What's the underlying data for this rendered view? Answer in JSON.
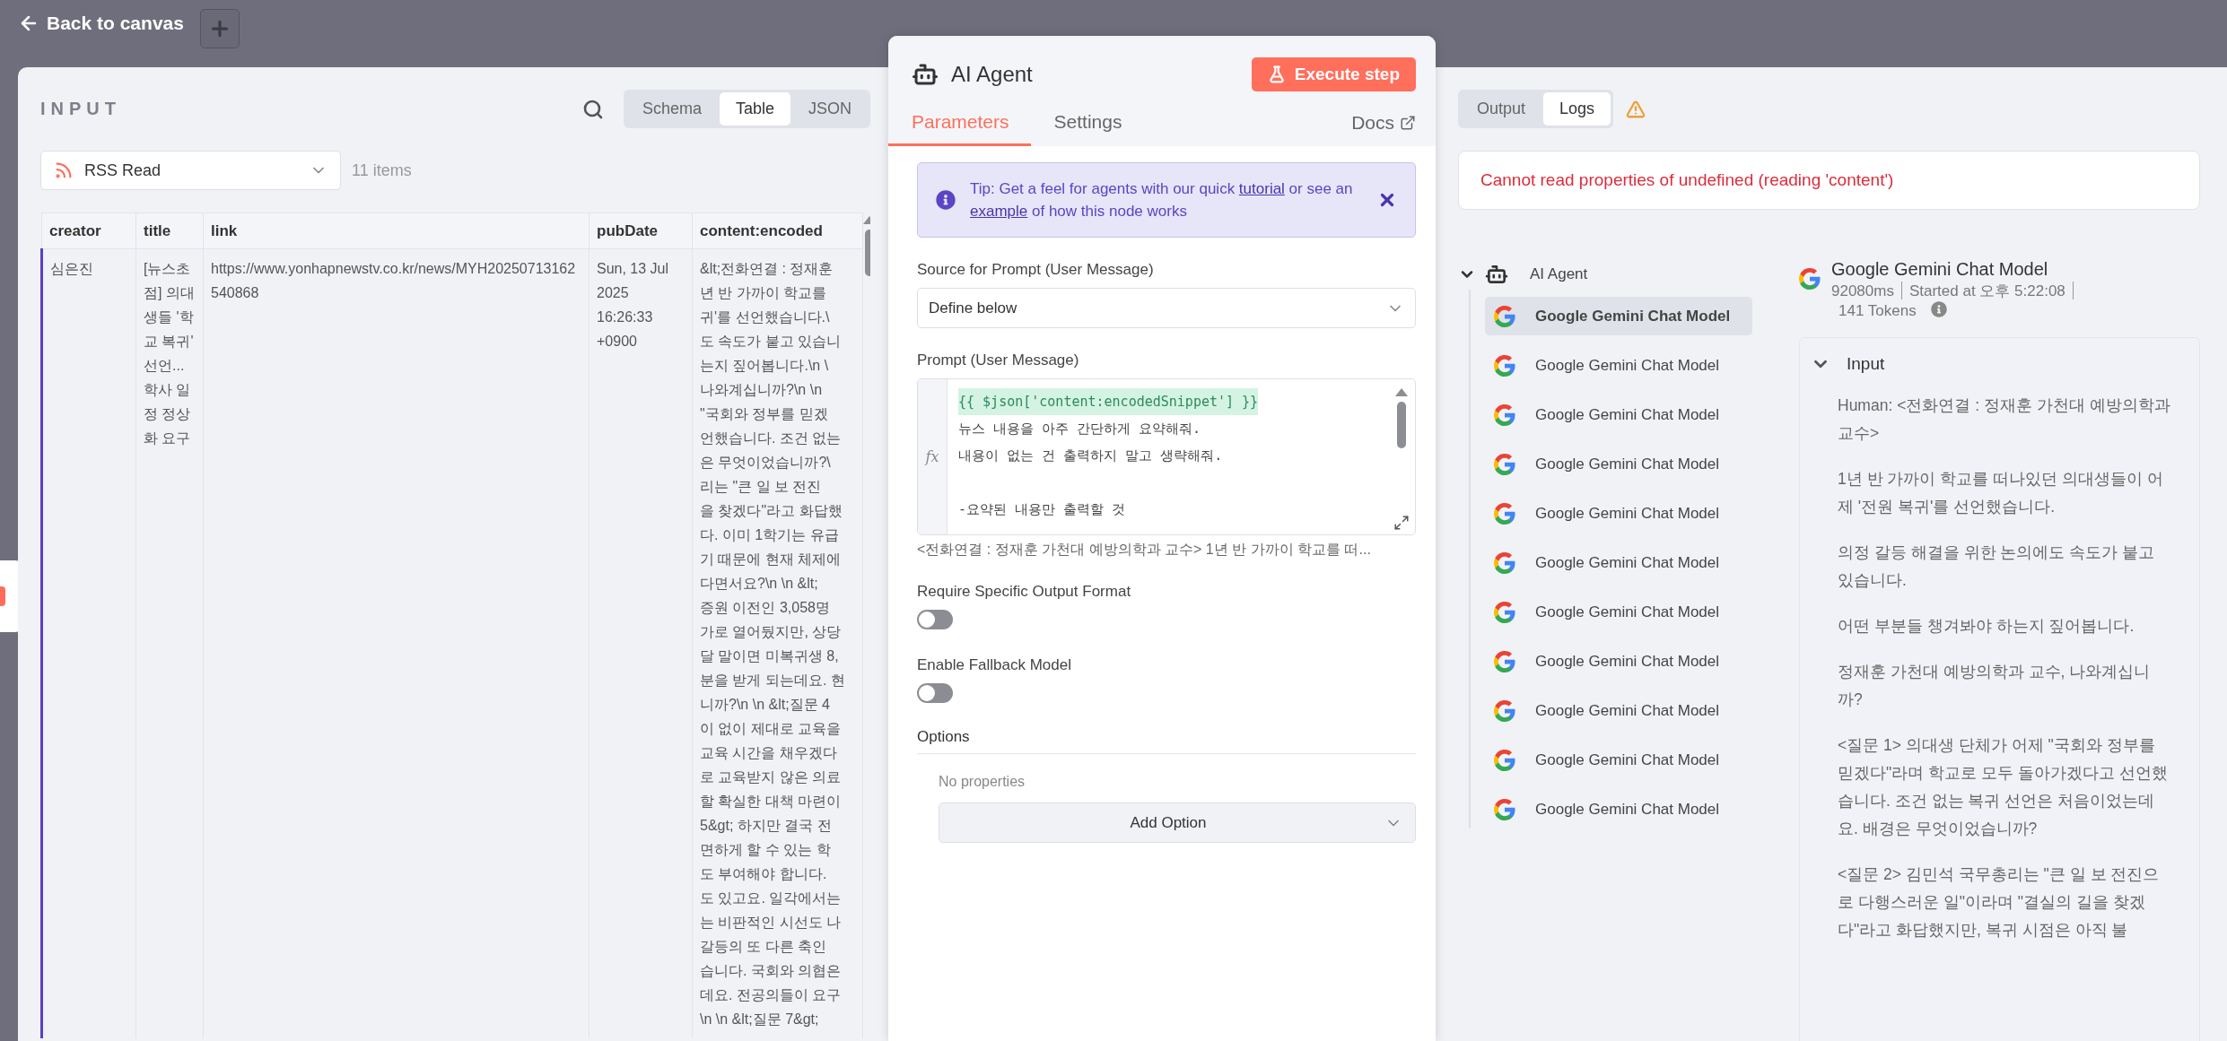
{
  "top_bar": {
    "back_label": "Back to canvas"
  },
  "input_panel": {
    "title": "INPUT",
    "views": [
      {
        "label": "Schema",
        "selected": false
      },
      {
        "label": "Table",
        "selected": true
      },
      {
        "label": "JSON",
        "selected": false
      }
    ],
    "source": "RSS Read",
    "item_count": "11 items",
    "table": {
      "columns": [
        "creator",
        "title",
        "link",
        "pubDate",
        "content:encoded"
      ],
      "rows": [
        {
          "selected": true,
          "creator": "심은진",
          "title": "[뉴스초점] 의대생들 '학교 복귀' 선언... 학사 일정 정상화 요구",
          "link": "https://www.yonhapnewstv.co.kr/news/MYH20250713162540868",
          "pubDate": "Sun, 13 Jul 2025 16:26:33 +0900",
          "content_lines": [
            "&lt;전화연결 : 정재훈",
            "년 반 가까이 학교를",
            "귀'를 선언했습니다.\\",
            "도 속도가 붙고 있습니",
            "는지 짚어봅니다.\\n \\",
            "나와계십니까?\\n \\n",
            "\"국회와 정부를 믿겠",
            "언했습니다. 조건 없는",
            "은 무엇이었습니까?\\",
            "리는 \"큰 일 보 전진",
            "을 찾겠다\"라고 화답했",
            "다. 이미 1학기는 유급",
            "기 때문에 현재 체제에",
            "다면서요?\\n \\n &lt;",
            "증원 이전인 3,058명",
            "가로 열어뒀지만, 상당",
            "달 말이면 미복귀생 8,",
            "분을 받게 되는데요. 현",
            "니까?\\n \\n &lt;질문 4",
            "이 없이 제대로 교육을",
            "교육 시간을 채우겠다",
            "로 교육받지 않은 의료",
            "할 확실한 대책 마련이",
            "5&gt; 하지만 결국 전",
            "면하게 할 수 있는 학",
            "도 부여해야 합니다.",
            "도 있고요. 일각에서는",
            "는 비판적인 시선도 나",
            "갈등의 또 다른 축인",
            "습니다. 국회와 의협은",
            "데요. 전공의들이 요구",
            "\\n \\n &lt;질문 7&gt;"
          ]
        }
      ]
    }
  },
  "node_panel": {
    "title": "AI Agent",
    "execute_label": "Execute step",
    "tabs": [
      {
        "label": "Parameters",
        "selected": true
      },
      {
        "label": "Settings",
        "selected": false
      }
    ],
    "docs_label": "Docs",
    "tip": {
      "before": "Tip: Get a feel for agents with our quick ",
      "link_1": "tutorial",
      "middle": " or see an ",
      "link_2": "example",
      "after": " of how this node works"
    },
    "source_prompt": {
      "label": "Source for Prompt (User Message)",
      "value": "Define below"
    },
    "prompt": {
      "label": "Prompt (User Message)",
      "gutter_label": "fx",
      "lines": [
        {
          "kind": "expression",
          "text": "{{ $json['content:encodedSnippet'] }}"
        },
        {
          "kind": "plain",
          "text": "뉴스 내용을 아주 간단하게 요약해줘."
        },
        {
          "kind": "plain",
          "text": "내용이 없는 건 출력하지 말고 생략해줘."
        },
        {
          "kind": "blank"
        },
        {
          "kind": "plain",
          "text": "-요약된 내용만 출력할 것"
        }
      ],
      "preview": "<전화연결 : 정재훈 가천대 예방의학과 교수> 1년 반 가까이 학교를 떠..."
    },
    "toggles": [
      {
        "label": "Require Specific Output Format",
        "on": false
      },
      {
        "label": "Enable Fallback Model",
        "on": false
      }
    ],
    "options": {
      "label": "Options",
      "empty_text": "No properties",
      "add_label": "Add Option"
    }
  },
  "logs_panel": {
    "views": [
      {
        "label": "Output",
        "selected": false
      },
      {
        "label": "Logs",
        "selected": true
      }
    ],
    "error": "Cannot read properties of undefined (reading 'content')",
    "tree": {
      "label": "AI Agent",
      "expanded": true,
      "children": [
        {
          "label": "Google Gemini Chat Model",
          "selected": true
        },
        {
          "label": "Google Gemini Chat Model",
          "selected": false
        },
        {
          "label": "Google Gemini Chat Model",
          "selected": false
        },
        {
          "label": "Google Gemini Chat Model",
          "selected": false
        },
        {
          "label": "Google Gemini Chat Model",
          "selected": false
        },
        {
          "label": "Google Gemini Chat Model",
          "selected": false
        },
        {
          "label": "Google Gemini Chat Model",
          "selected": false
        },
        {
          "label": "Google Gemini Chat Model",
          "selected": false
        },
        {
          "label": "Google Gemini Chat Model",
          "selected": false
        },
        {
          "label": "Google Gemini Chat Model",
          "selected": false
        },
        {
          "label": "Google Gemini Chat Model",
          "selected": false
        }
      ]
    },
    "detail": {
      "title": "Google Gemini Chat Model",
      "duration": "92080ms",
      "started": "Started at 오후 5:22:08",
      "tokens": "141 Tokens",
      "input": {
        "heading": "Input",
        "expanded": true,
        "paragraphs": [
          "Human: <전화연결 : 정재훈 가천대 예방의학과 교수>",
          "1년 반 가까이 학교를 떠나있던 의대생들이 어제 '전원 복귀'를 선언했습니다.",
          "의정 갈등 해결을 위한 논의에도 속도가 붙고 있습니다.",
          "어떤 부분들 챙겨봐야 하는지 짚어봅니다.",
          "정재훈 가천대 예방의학과 교수, 나와계십니까?",
          "<질문 1> 의대생 단체가 어제 \"국회와 정부를 믿겠다\"라며 학교로 모두 돌아가겠다고 선언했습니다. 조건 없는 복귀 선언은 처음이었는데요. 배경은 무엇이었습니까?",
          "<질문 2> 김민석 국무총리는 \"큰 일 보 전진으로 다행스러운 일\"이라며 \"결실의 길을 찾겠다\"라고 화답했지만, 복귀 시점은 아직 불"
        ]
      }
    }
  }
}
